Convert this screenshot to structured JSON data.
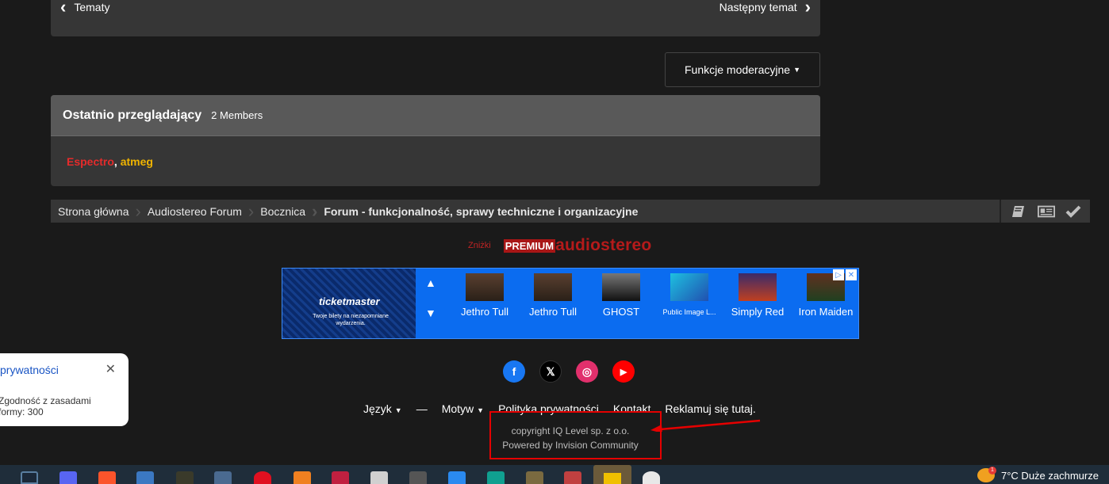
{
  "topnav": {
    "prev_label": "Tematy",
    "next_label": "Następny temat"
  },
  "moderation": {
    "label": "Funkcje moderacyjne"
  },
  "viewers": {
    "title": "Ostatnio przeglądający",
    "count": "2 Members",
    "users": [
      {
        "name": "Espectro",
        "color": "#e52b2b"
      },
      {
        "name": "atmeg",
        "color": "#f0b400"
      }
    ],
    "separator": ","
  },
  "breadcrumb": {
    "items": [
      "Strona główna",
      "Audiostereo Forum",
      "Bocznica",
      "Forum - funkcjonalność, sprawy techniczne i organizacyjne"
    ]
  },
  "promo": {
    "small": "Zniżki",
    "badge": "PREMIUM",
    "brand": "audiostereo"
  },
  "ad": {
    "brand": "ticketmaster",
    "tagline": "Twoje bilety na niezapomniane wydarzenia.",
    "items": [
      "Jethro Tull",
      "Jethro Tull",
      "GHOST",
      "Public Image L...",
      "Simply Red",
      "Iron Maiden"
    ],
    "up": "▲",
    "down": "▼"
  },
  "social": [
    {
      "name": "facebook-icon",
      "glyph": "f",
      "color": "#1877f2"
    },
    {
      "name": "x-icon",
      "glyph": "𝕏",
      "color": "#000000"
    },
    {
      "name": "instagram-icon",
      "glyph": "◎",
      "color": "#e1306c"
    },
    {
      "name": "youtube-icon",
      "glyph": "▶",
      "color": "#ff0000"
    }
  ],
  "footer": {
    "language": "Język",
    "dash": "—",
    "theme": "Motyw",
    "privacy": "Polityka prywatności",
    "contact": "Kontakt",
    "advertise": "Reklamuj się tutaj.",
    "copyright": "copyright IQ Level sp. z o.o.",
    "powered": "Powered by Invision Community"
  },
  "privacy_popup": {
    "title": "prywatności",
    "text_line1": "Zgodność z zasadami",
    "text_line2": "formy: 300"
  },
  "taskbar": {
    "weather": "7°C  Duże zachmurze",
    "badge": "1"
  }
}
